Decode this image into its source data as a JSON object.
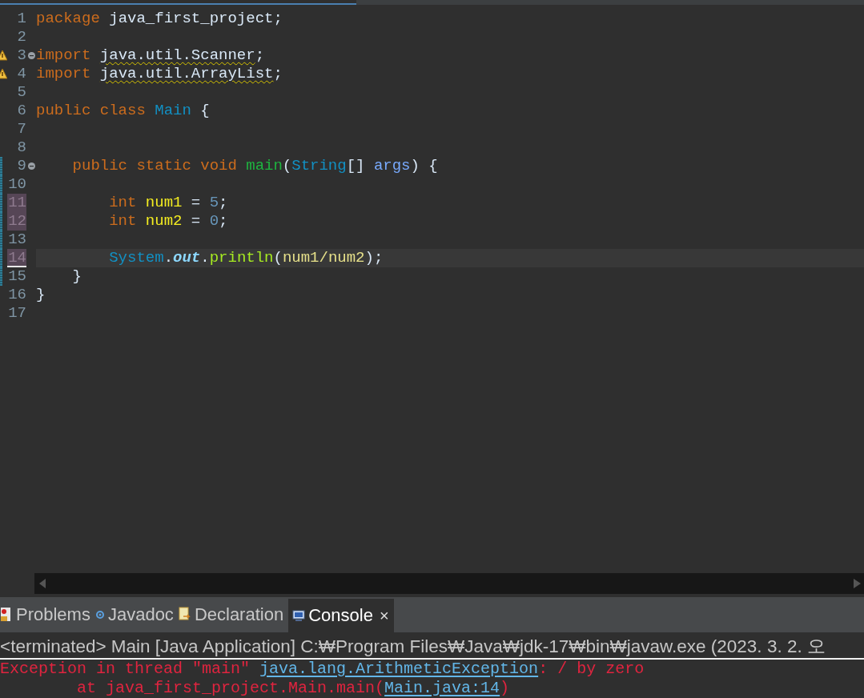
{
  "editor": {
    "lines": [
      {
        "number": "1",
        "tokens": [
          {
            "kind": "keyword",
            "text": "package"
          },
          {
            "kind": "plain",
            "text": " java_first_project;"
          }
        ]
      },
      {
        "number": "2"
      },
      {
        "number": "3",
        "fold": true,
        "warning": true,
        "tokens": [
          {
            "kind": "keyword",
            "text": "import "
          },
          {
            "kind": "warning",
            "text": "java.util.Scanner"
          },
          {
            "kind": "plain",
            "text": ";"
          }
        ]
      },
      {
        "number": "4",
        "warning": true,
        "tokens": [
          {
            "kind": "keyword",
            "text": "import "
          },
          {
            "kind": "warning",
            "text": "java.util.ArrayList"
          },
          {
            "kind": "plain",
            "text": ";"
          }
        ]
      },
      {
        "number": "5"
      },
      {
        "number": "6",
        "tokens": [
          {
            "kind": "keyword",
            "text": "public class "
          },
          {
            "kind": "type",
            "text": "Main"
          },
          {
            "kind": "plain",
            "text": " {"
          }
        ]
      },
      {
        "number": "7"
      },
      {
        "number": "8"
      },
      {
        "number": "9",
        "fold": true,
        "changed": true,
        "tokens": [
          {
            "kind": "keyword",
            "text": "    public static void "
          },
          {
            "kind": "method",
            "text": "main"
          },
          {
            "kind": "plain",
            "text": "("
          },
          {
            "kind": "type",
            "text": "String"
          },
          {
            "kind": "plain",
            "text": "[] "
          },
          {
            "kind": "param",
            "text": "args"
          },
          {
            "kind": "plain",
            "text": ") {"
          }
        ]
      },
      {
        "number": "10",
        "changed": true
      },
      {
        "number": "11",
        "changed": true,
        "marked": true,
        "tokens": [
          {
            "kind": "keyword",
            "text": "        int "
          },
          {
            "kind": "local",
            "text": "num1"
          },
          {
            "kind": "plain",
            "text": " = "
          },
          {
            "kind": "number",
            "text": "5"
          },
          {
            "kind": "plain",
            "text": ";"
          }
        ]
      },
      {
        "number": "12",
        "changed": true,
        "marked": true,
        "tokens": [
          {
            "kind": "keyword",
            "text": "        int "
          },
          {
            "kind": "local",
            "text": "num2"
          },
          {
            "kind": "plain",
            "text": " = "
          },
          {
            "kind": "number",
            "text": "0"
          },
          {
            "kind": "plain",
            "text": ";"
          }
        ]
      },
      {
        "number": "13",
        "changed": true
      },
      {
        "number": "14",
        "changed": true,
        "marked": true,
        "current": true,
        "tokens": [
          {
            "kind": "type",
            "text": "        System"
          },
          {
            "kind": "plain",
            "text": "."
          },
          {
            "kind": "field",
            "text": "out"
          },
          {
            "kind": "plain",
            "text": "."
          },
          {
            "kind": "call",
            "text": "println"
          },
          {
            "kind": "plain",
            "text": "("
          },
          {
            "kind": "localuse",
            "text": "num1/num2"
          },
          {
            "kind": "plain",
            "text": ");"
          }
        ]
      },
      {
        "number": "15",
        "changed": true,
        "tokens": [
          {
            "kind": "plain",
            "text": "    }"
          }
        ]
      },
      {
        "number": "16",
        "tokens": [
          {
            "kind": "plain",
            "text": "}"
          }
        ]
      },
      {
        "number": "17"
      }
    ]
  },
  "panel": {
    "tabs": [
      {
        "label": "Problems",
        "kind": "problems",
        "selected": false
      },
      {
        "label": "Javadoc",
        "kind": "javadoc",
        "selected": false
      },
      {
        "label": "Declaration",
        "kind": "declaration",
        "selected": false
      },
      {
        "label": "Console",
        "kind": "console",
        "selected": true,
        "close": "×"
      }
    ]
  },
  "console": {
    "header": "<terminated> Main [Java Application] C:₩Program Files₩Java₩jdk-17₩bin₩javaw.exe  (2023. 3. 2. 오",
    "lines": [
      [
        {
          "kind": "error",
          "text": "Exception in thread \"main\" "
        },
        {
          "kind": "link",
          "text": "java.lang.ArithmeticException"
        },
        {
          "kind": "error",
          "text": ": / by zero"
        }
      ],
      [
        {
          "kind": "error",
          "text": "        at java_first_project.Main.main("
        },
        {
          "kind": "link",
          "text": "Main.java:14"
        },
        {
          "kind": "error",
          "text": ")"
        }
      ]
    ]
  }
}
